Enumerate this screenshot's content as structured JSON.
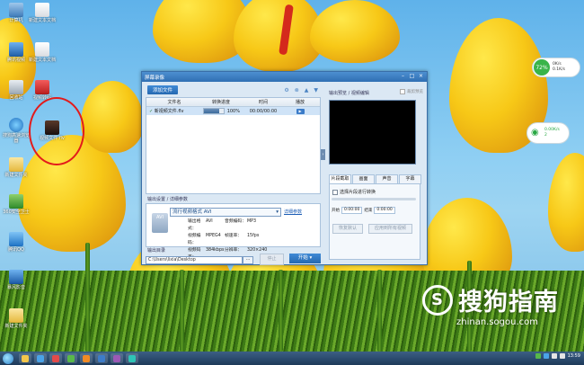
{
  "desktop": {
    "icons": [
      {
        "label": "计算机"
      },
      {
        "label": "新建文本文档"
      },
      {
        "label": "腾讯视频"
      },
      {
        "label": "新建文本文档"
      },
      {
        "label": "回收站"
      },
      {
        "label": "视频转码"
      },
      {
        "label": "搜狗高速浏览器"
      },
      {
        "label": "视频文件 flv"
      },
      {
        "label": "新建文件夹"
      },
      {
        "label": "360安全卫士"
      },
      {
        "label": "腾讯QQ"
      },
      {
        "label": "暴风影音"
      },
      {
        "label": "新建文件夹"
      }
    ]
  },
  "widget": {
    "percent": "72%",
    "up": "0K/s",
    "down": "0.1K/s",
    "wifi_speed": "0.00K/s",
    "wifi_count": "2"
  },
  "window": {
    "title": "屏幕录像",
    "add_button": "添加文件",
    "table_headers": [
      "文件名",
      "转换进度",
      "时间",
      "播放"
    ],
    "files": [
      {
        "name": "新视频文件.flv",
        "progress": 0.8,
        "progress_text": "100%",
        "time": "00:00/00:00"
      }
    ],
    "output_section_label": "输出设置 / 详细参数",
    "format_label": "流行视频格式  AVI",
    "detail_link": "详细参数",
    "format_icon_text": "AVI",
    "props": [
      {
        "k": "输出格式：",
        "v": "AVI",
        "k2": "音频编码：",
        "v2": "MP3"
      },
      {
        "k": "视频编码：",
        "v": "MPEG4",
        "k2": "帧速率：",
        "v2": "15fps"
      },
      {
        "k": "视频码率：",
        "v": "384kbps",
        "k2": "分辨率：",
        "v2": "320×240"
      }
    ],
    "output_dir_label": "输出目录",
    "path": "C:\\Users\\lixia\\Desktop",
    "browse": "...",
    "stop_button": "停止",
    "start_button": "开始",
    "preview_title": "输出预览 / 视频编辑",
    "preview_check": "裁剪预览",
    "tabs": [
      "片段截取",
      "画面",
      "声音",
      "字幕"
    ],
    "clip_check": "选择片段进行转换",
    "start_label": "开始",
    "start_time": "0:00:00",
    "end_label": "结束",
    "end_time": "0:00:00",
    "reset_button": "恢复默认",
    "apply_button": "应用到所有视频"
  },
  "watermark": {
    "logo": "S",
    "text": "搜狗指南",
    "url": "zhinan.sogou.com"
  },
  "taskbar": {
    "time": "13:59"
  }
}
